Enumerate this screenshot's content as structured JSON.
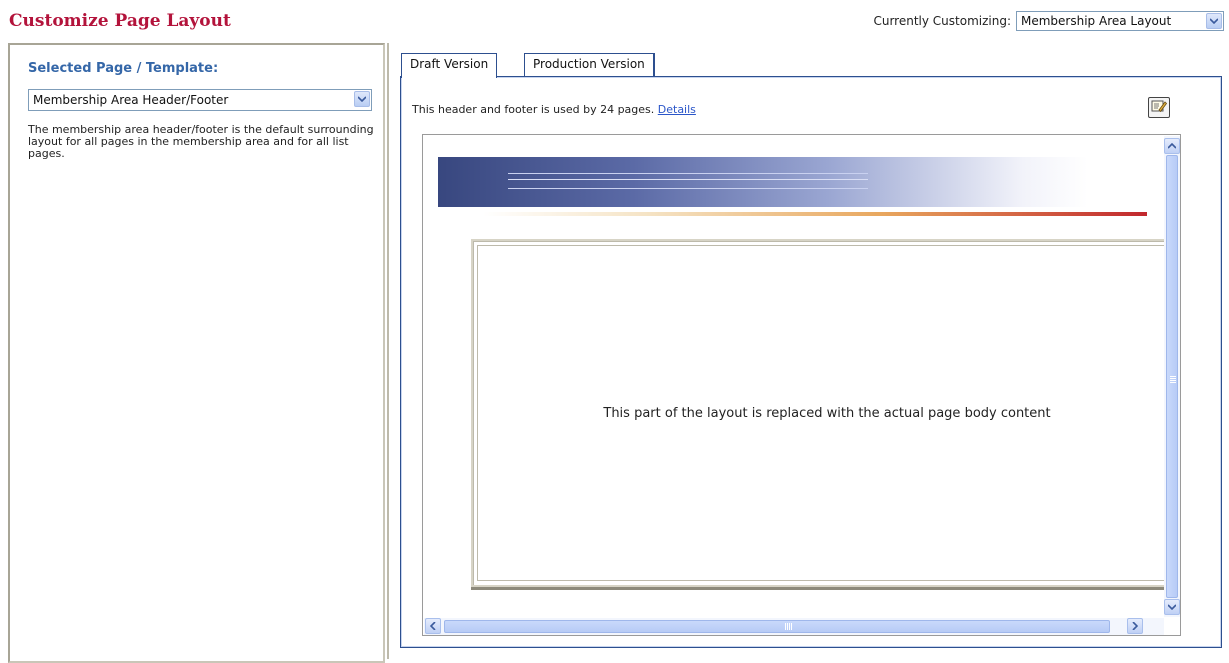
{
  "header": {
    "title": "Customize Page Layout",
    "customizing_label": "Currently Customizing:",
    "customizing_value": "Membership Area Layout"
  },
  "left": {
    "heading": "Selected Page / Template:",
    "selected_template": "Membership Area Header/Footer",
    "description": "The membership area header/footer is the default surrounding layout for all pages in the membership area and for all list pages."
  },
  "tabs": [
    {
      "label": "Draft Version",
      "active": true
    },
    {
      "label": "Production Version",
      "active": false
    }
  ],
  "content": {
    "usage_text": "This header and footer is used by 24 pages.",
    "details_link": "Details",
    "placeholder_text": "This part of the layout is replaced with the actual page body content",
    "edit_icon": "edit-icon"
  },
  "colors": {
    "title": "#b3133b",
    "heading": "#3567a8",
    "link": "#2b56c9",
    "tab_border": "#2d4f8f"
  }
}
